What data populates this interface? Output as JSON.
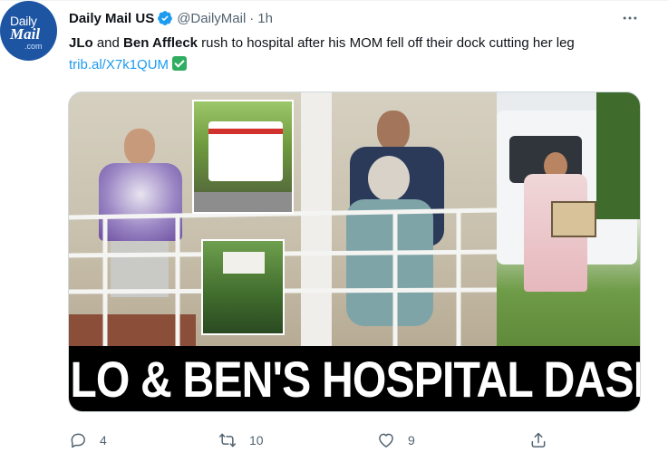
{
  "avatar": {
    "line1": "Daily",
    "line2": "Mail",
    "line3": ".com"
  },
  "header": {
    "display_name": "Daily Mail US",
    "handle": "@DailyMail",
    "separator": "·",
    "time": "1h"
  },
  "tweet": {
    "name1": "JLo",
    "text1": " and ",
    "name2": "Ben Affleck",
    "text2": " rush to hospital after his MOM fell off their dock cutting her leg ",
    "link": "trib.al/X7k1QUM",
    "emoji": "check-mark-button"
  },
  "media": {
    "headline": "JLO & BEN'S HOSPITAL DASH"
  },
  "actions": {
    "reply_count": "4",
    "retweet_count": "10",
    "like_count": "9"
  },
  "colors": {
    "accent": "#1d9bf0",
    "text_secondary": "#536471",
    "verified": "#1d9bf0",
    "avatar_bg": "#1d55a3"
  }
}
